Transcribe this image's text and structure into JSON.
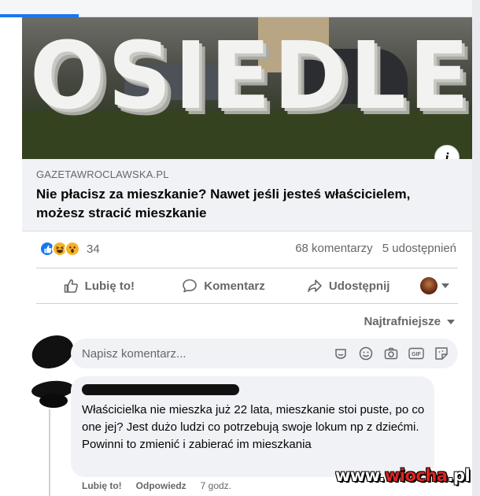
{
  "post": {
    "image_caption_letters": "OSIEDLE",
    "info_icon": "info-icon",
    "link": {
      "domain": "GAZETAWROCLAWSKA.PL",
      "headline": "Nie płacisz za mieszkanie? Nawet jeśli jesteś właścicielem, możesz stracić mieszkanie"
    },
    "stats": {
      "reactions": [
        "like-icon",
        "haha-icon",
        "wow-icon"
      ],
      "reaction_count": "34",
      "comments": "68 komentarzy",
      "shares": "5 udostępnień"
    },
    "actions": {
      "like": "Lubię to!",
      "comment": "Komentarz",
      "share": "Udostępnij"
    },
    "sort_label": "Najtrafniejsze",
    "composer": {
      "placeholder": "Napisz komentarz...",
      "icons": [
        "sticker-face-icon",
        "emoji-icon",
        "camera-icon",
        "gif-icon",
        "sticker-icon"
      ]
    },
    "comment": {
      "text": "Właścicielka nie mieszka już 22 lata, mieszkanie stoi puste, po co one jej? Jest dużo ludzi co potrzebują swoje lokum np z dziećmi. Powinni to zmienić i zabierać im mieszkania",
      "like": "Lubię to!",
      "reply": "Odpowiedz",
      "time": "7 godz."
    }
  },
  "watermark": {
    "part1": "www.",
    "part2": "wiocha",
    "part3": ".pl"
  },
  "colors": {
    "accent": "#1877f2",
    "secondary_text": "#65676b",
    "bubble": "#f0f2f5"
  }
}
